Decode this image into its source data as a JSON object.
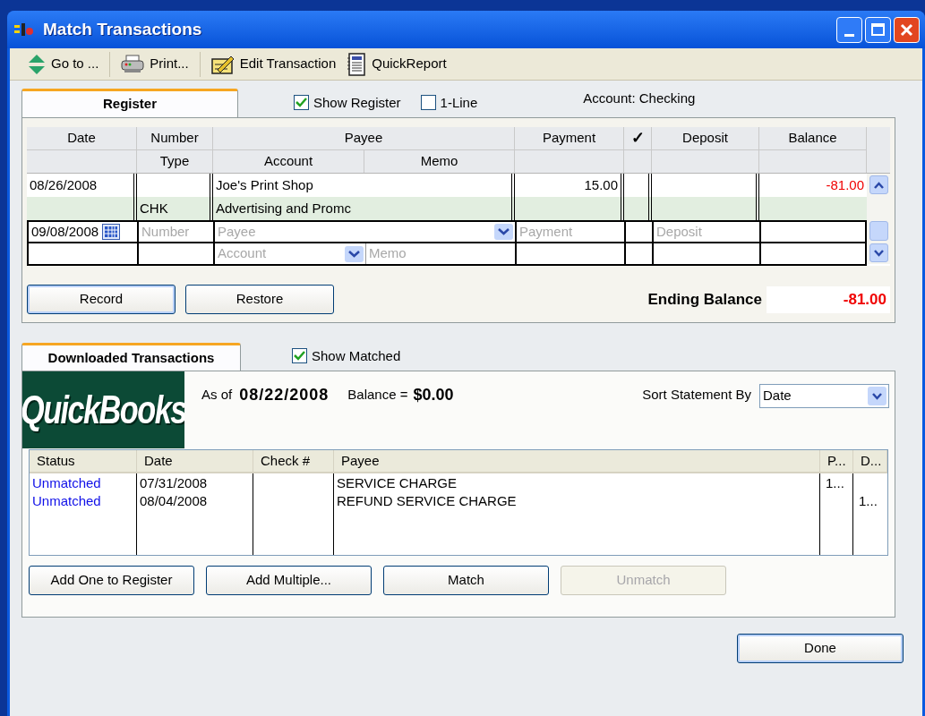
{
  "window": {
    "title": "Match Transactions"
  },
  "toolbar": [
    {
      "kind": "goto",
      "label": "Go to ..."
    },
    {
      "kind": "print",
      "label": "Print..."
    },
    {
      "kind": "edit",
      "label": "Edit Transaction"
    },
    {
      "kind": "report",
      "label": "QuickReport"
    }
  ],
  "register": {
    "tab": {
      "label": "Register",
      "selected": true
    },
    "show_register": {
      "label": "Show Register",
      "checked": true
    },
    "one_line": {
      "label": "1-Line",
      "checked": false
    },
    "account": "Account: Checking",
    "columns": [
      "Date",
      "Number",
      "Payee",
      "Payment",
      "✓",
      "Deposit",
      "Balance"
    ],
    "subcolumns": [
      "Type",
      "Account",
      "Memo"
    ],
    "transactions": [
      {
        "date": "08/26/2008",
        "payee": "Joe's Print Shop",
        "payment": "15.00",
        "balance": "-81.00",
        "negative": true,
        "type": "CHK",
        "account": "Advertising and Promc"
      }
    ],
    "new_entry": {
      "date": "09/08/2008",
      "number": "Number",
      "payee": "Payee",
      "payment": "Payment",
      "deposit": "Deposit",
      "account": "Account",
      "memo": "Memo"
    },
    "buttons": [
      "Record",
      "Restore"
    ],
    "ending_balance": {
      "label": "Ending Balance",
      "value": "-81.00",
      "negative": true
    }
  },
  "downloaded": {
    "tab": {
      "label": "Downloaded Transactions",
      "selected": true
    },
    "show_matched": {
      "label": "Show Matched",
      "checked": true
    },
    "logo_text": "QuickBooks",
    "as_of": {
      "label": "As of",
      "value": "08/22/2008"
    },
    "balance": {
      "label": "Balance =",
      "value": "$0.00"
    },
    "sort": {
      "label": "Sort Statement By",
      "value": "Date"
    },
    "columns": [
      "Status",
      "Date",
      "Check #",
      "Payee",
      "P...",
      "D..."
    ],
    "rows": [
      {
        "status": "Unmatched",
        "date": "07/31/2008",
        "payee": "SERVICE CHARGE",
        "p": "1..."
      },
      {
        "status": "Unmatched",
        "date": "08/04/2008",
        "payee": "REFUND SERVICE CHARGE",
        "d": "1..."
      }
    ],
    "buttons": [
      {
        "label": "Add One to Register",
        "disabled": false
      },
      {
        "label": "Add Multiple...",
        "disabled": false
      },
      {
        "label": "Match",
        "disabled": false
      },
      {
        "label": "Unmatch",
        "disabled": true
      }
    ]
  },
  "done": "Done"
}
